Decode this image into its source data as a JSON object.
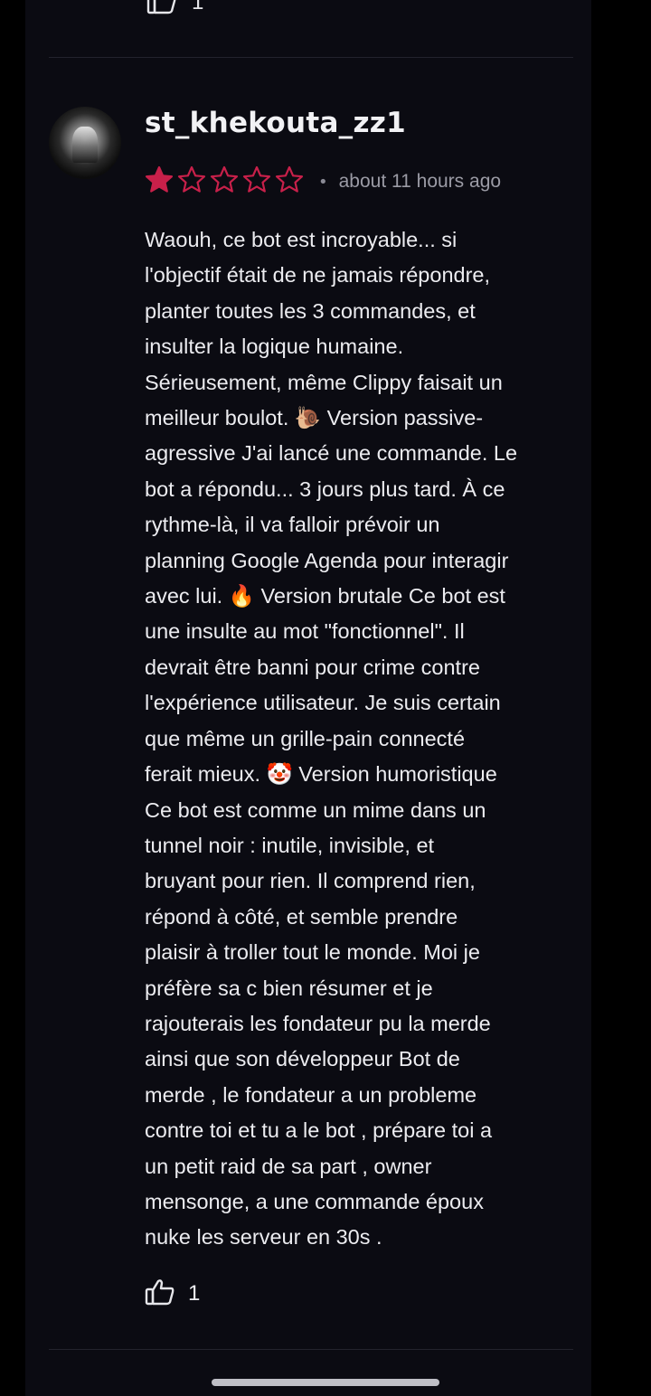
{
  "previous_review": {
    "like_count": "1"
  },
  "review": {
    "username": "st_khekouta_zz1",
    "rating": 1,
    "max_rating": 5,
    "separator": "•",
    "timestamp": "about 11 hours ago",
    "text_lines": [
      "Waouh, ce bot est incroyable... si",
      "l'objectif était de ne jamais répondre,",
      "planter toutes les 3 commandes, et",
      "insulter la logique humaine.",
      "Sérieusement, même Clippy faisait un",
      "meilleur boulot. 🐌 Version passive-",
      "agressive J'ai lancé une commande. Le",
      "bot a répondu... 3 jours plus tard. À ce",
      "rythme-là, il va falloir prévoir un",
      "planning Google Agenda pour interagir",
      "avec lui. 🔥 Version brutale Ce bot est",
      "une insulte au mot \"fonctionnel\". Il",
      "devrait être banni pour crime contre",
      "l'expérience utilisateur. Je suis certain",
      "que même un grille-pain connecté",
      "ferait mieux. 🤡 Version humoristique",
      "Ce bot est comme un mime dans un",
      "tunnel noir : inutile, invisible, et",
      "bruyant pour rien. Il comprend rien,",
      "répond à côté, et semble prendre",
      "plaisir à troller tout le monde. Moi je",
      "préfère sa c bien résumer et je",
      "rajouterais les fondateur pu la merde",
      "ainsi que son développeur Bot de",
      "merde , le fondateur a un probleme",
      "contre toi et tu a le bot , prépare toi a",
      "un petit raid de sa part , owner",
      "mensonge, a une commande époux",
      "nuke les serveur en 30s ."
    ],
    "like_count": "1"
  },
  "colors": {
    "background": "#000000",
    "panel": "#0b0b12",
    "star_accent": "#c8204a",
    "text": "#ececf0",
    "muted": "#9b9ba5"
  },
  "icons": {
    "like": "thumbs-up-icon",
    "star": "star-icon",
    "avatar": "user-avatar"
  }
}
